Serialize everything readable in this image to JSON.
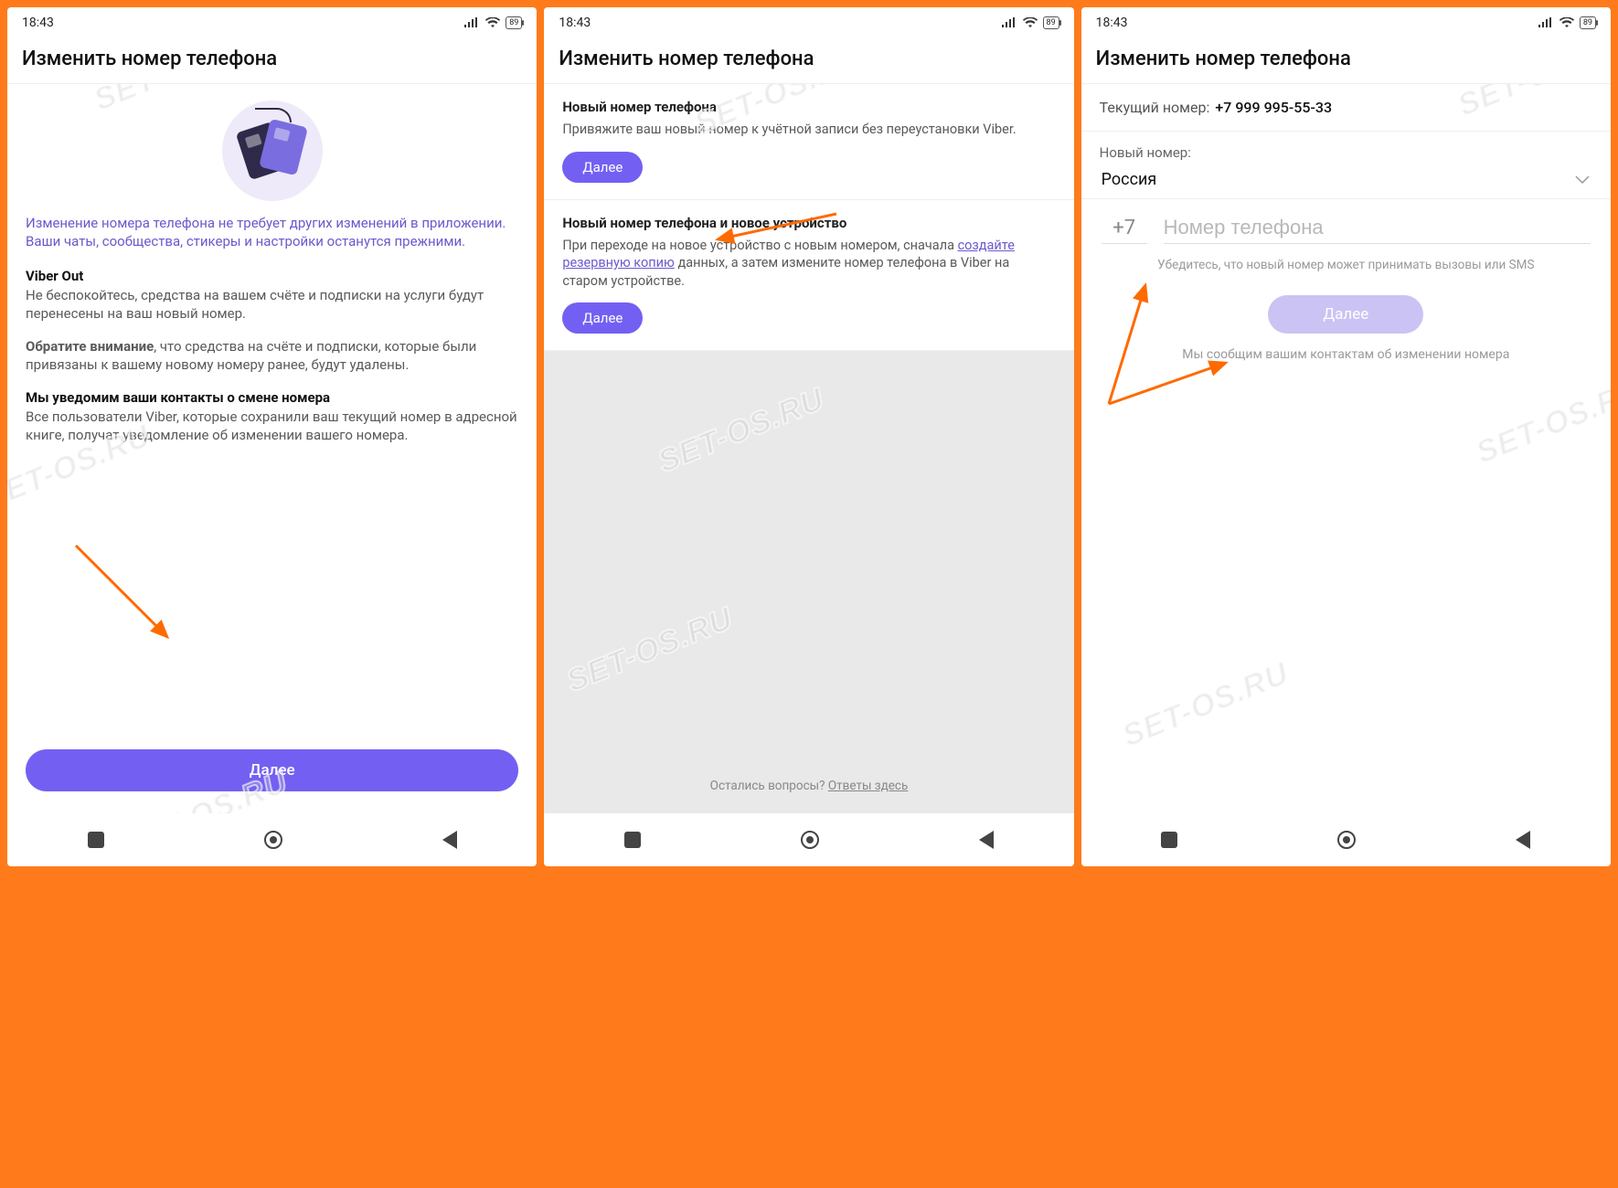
{
  "status": {
    "time": "18:43",
    "battery": "89"
  },
  "header": "Изменить номер телефона",
  "s1": {
    "intro": "Изменение номера телефона не требует других изменений в приложении. Ваши чаты, сообщества, стикеры и настройки останутся прежними.",
    "sec1_title": "Viber Out",
    "sec1_text": "Не беспокойтесь, средства на вашем счёте и подписки на услуги будут перенесены на ваш новый номер.",
    "sec2_prefix": "Обратите внимание",
    "sec2_rest": ", что средства на счёте и подписки, которые были привязаны к вашему новому номеру ранее, будут удалены.",
    "sec3_title": "Мы уведомим ваши контакты о смене номера",
    "sec3_text": "Все пользователи Viber, которые сохранили ваш текущий номер в адресной книге, получат уведомление об изменении вашего номера.",
    "next": "Далее"
  },
  "s2": {
    "b1_title": "Новый номер телефона",
    "b1_text": "Привяжите ваш новый номер к учётной записи без переустановки Viber.",
    "b1_btn": "Далее",
    "b2_title": "Новый номер телефона и новое устройство",
    "b2_pre": "При переходе на новое устройство с новым номером, сначала ",
    "b2_link": "создайте резервную копию",
    "b2_post": " данных, а затем измените номер телефона в Viber на старом устройстве.",
    "b2_btn": "Далее",
    "footer_q": "Остались вопросы? ",
    "footer_link": "Ответы здесь"
  },
  "s3": {
    "cur_label": "Текущий номер:",
    "cur_value": "+7 999 995-55-33",
    "new_label": "Новый номер:",
    "country": "Россия",
    "prefix": "+7",
    "placeholder": "Номер телефона",
    "hint": "Убедитесь, что новый номер может принимать вызовы или SMS",
    "next": "Далее",
    "note": "Мы сообщим вашим контактам об изменении номера"
  },
  "watermark": "SET-OS.RU"
}
